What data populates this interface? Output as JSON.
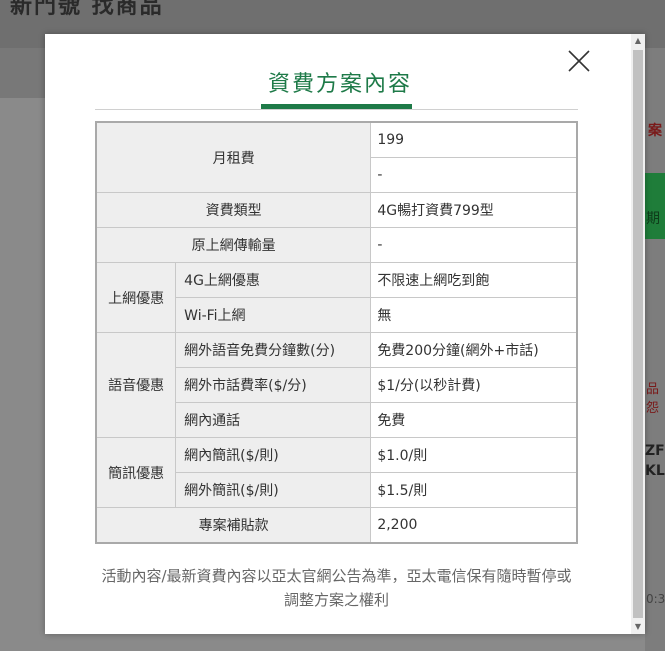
{
  "modal": {
    "title": "資費方案內容",
    "close_icon": "close-icon",
    "note": "活動內容/最新資費內容以亞太官網公告為準，亞太電信保有隨時暫停或調整方案之權利"
  },
  "table": {
    "rows": {
      "monthly_fee": {
        "label": "月租費",
        "value1": "199",
        "value2": "-"
      },
      "plan_type": {
        "label": "資費類型",
        "value": "4G暢打資費799型"
      },
      "original_data": {
        "label": "原上網傳輸量",
        "value": "-"
      },
      "internet": {
        "group": "上網優惠",
        "row1_label": "4G上網優惠",
        "row1_value": "不限速上網吃到飽",
        "row2_label": "Wi-Fi上網",
        "row2_value": "無"
      },
      "voice": {
        "group": "語音優惠",
        "row1_label": "網外語音免費分鐘數(分)",
        "row1_value": "免費200分鐘(網外+市話)",
        "row2_label": "網外市話費率($/分)",
        "row2_value": "$1/分(以秒計費)",
        "row3_label": "網內通話",
        "row3_value": "免費"
      },
      "sms": {
        "group": "簡訊優惠",
        "row1_label": "網內簡訊($/則)",
        "row1_value": "$1.0/則",
        "row2_label": "網外簡訊($/則)",
        "row2_value": "$1.5/則"
      },
      "subsidy": {
        "label": "專案補貼款",
        "value": "2,200"
      }
    }
  },
  "background": {
    "top_text": "新門號 找商品",
    "frag1": "案",
    "frag2": "期",
    "frag3": "品怨",
    "frag4": "ZF",
    "frag5": "KL",
    "frag6": "0:3"
  },
  "colors": {
    "accent": "#1e7a48",
    "overlay": "#8a8a8a"
  }
}
